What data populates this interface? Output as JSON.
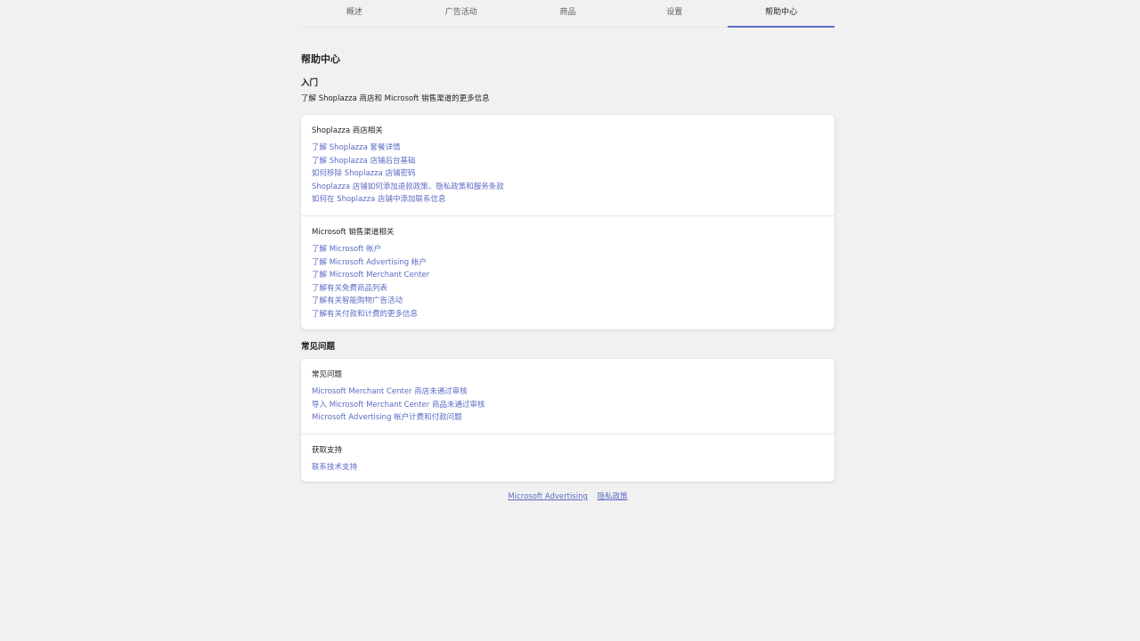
{
  "tabs": [
    {
      "label": "概述"
    },
    {
      "label": "广告活动"
    },
    {
      "label": "商品"
    },
    {
      "label": "设置"
    },
    {
      "label": "帮助中心",
      "active": true
    }
  ],
  "page": {
    "title": "帮助中心",
    "getting_started": {
      "heading": "入门",
      "description": "了解 Shoplazza 商店和 Microsoft 销售渠道的更多信息"
    },
    "shoplazza_section": {
      "title": "Shoplazza 商店相关",
      "links": [
        "了解 Shoplazza 套餐详情",
        "了解 Shoplazza 店铺后台基础",
        "如何移除 Shoplazza 店铺密码",
        "Shoplazza 店铺如何添加退款政策、隐私政策和服务条款",
        "如何在 Shoplazza 店铺中添加联系信息"
      ]
    },
    "microsoft_section": {
      "title": "Microsoft 销售渠道相关",
      "links": [
        "了解 Microsoft 帐户",
        "了解 Microsoft Advertising 帐户",
        "了解 Microsoft Merchant Center",
        "了解有关免费商品列表",
        "了解有关智能购物广告活动",
        "了解有关付款和计费的更多信息"
      ]
    },
    "faq": {
      "heading": "常见问题",
      "section_title": "常见问题",
      "links": [
        "Microsoft Merchant Center 商店未通过审核",
        "导入 Microsoft Merchant Center 商品未通过审核",
        "Microsoft Advertising 帐户计费和付款问题"
      ]
    },
    "support": {
      "title": "获取支持",
      "links": [
        "联系技术支持"
      ]
    }
  },
  "footer": {
    "links": [
      "Microsoft Advertising",
      "隐私政策"
    ]
  },
  "colors": {
    "background": "#f1f1f1",
    "link": "#5c6ac4",
    "active_tab_indicator": "#5c6ac4"
  }
}
